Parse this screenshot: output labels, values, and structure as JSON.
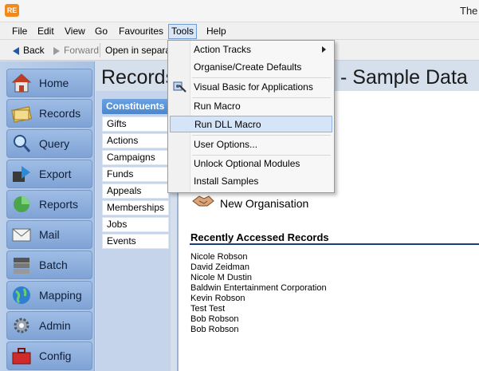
{
  "app": {
    "icon_text": "RE",
    "title": "The"
  },
  "menubar": {
    "file": "File",
    "edit": "Edit",
    "view": "View",
    "go": "Go",
    "favourites": "Favourites",
    "tools": "Tools",
    "help": "Help"
  },
  "toolbar": {
    "back": "Back",
    "forward": "Forward",
    "open_separate": "Open in separate"
  },
  "leftnav": [
    "Home",
    "Records",
    "Query",
    "Export",
    "Reports",
    "Mail",
    "Batch",
    "Mapping",
    "Admin",
    "Config"
  ],
  "subnav": {
    "header": "Constituents",
    "items": [
      "Gifts",
      "Actions",
      "Campaigns",
      "Funds",
      "Appeals",
      "Memberships",
      "Jobs",
      "Events"
    ]
  },
  "heading": {
    "left": "Records",
    "right": "- Sample Data"
  },
  "new_org": "New Organisation",
  "recent": {
    "title": "Recently Accessed Records",
    "items": [
      "Nicole Robson",
      "David Zeidman",
      "Nicole M Dustin",
      "Baldwin Entertainment Corporation",
      "Kevin Robson",
      "Test Test",
      "Bob Robson",
      "Bob Robson"
    ]
  },
  "tools_menu": {
    "items": [
      "Action Tracks",
      "Organise/Create Defaults",
      "Visual Basic for Applications",
      "Run Macro",
      "Run DLL Macro",
      "User Options...",
      "Unlock Optional Modules",
      "Install Samples"
    ],
    "highlighted": "Run DLL Macro"
  },
  "colors": {
    "accent": "#4b86cf",
    "menu_highlight": "#d5e4f7",
    "nav_bg": "#a9c2e3"
  }
}
